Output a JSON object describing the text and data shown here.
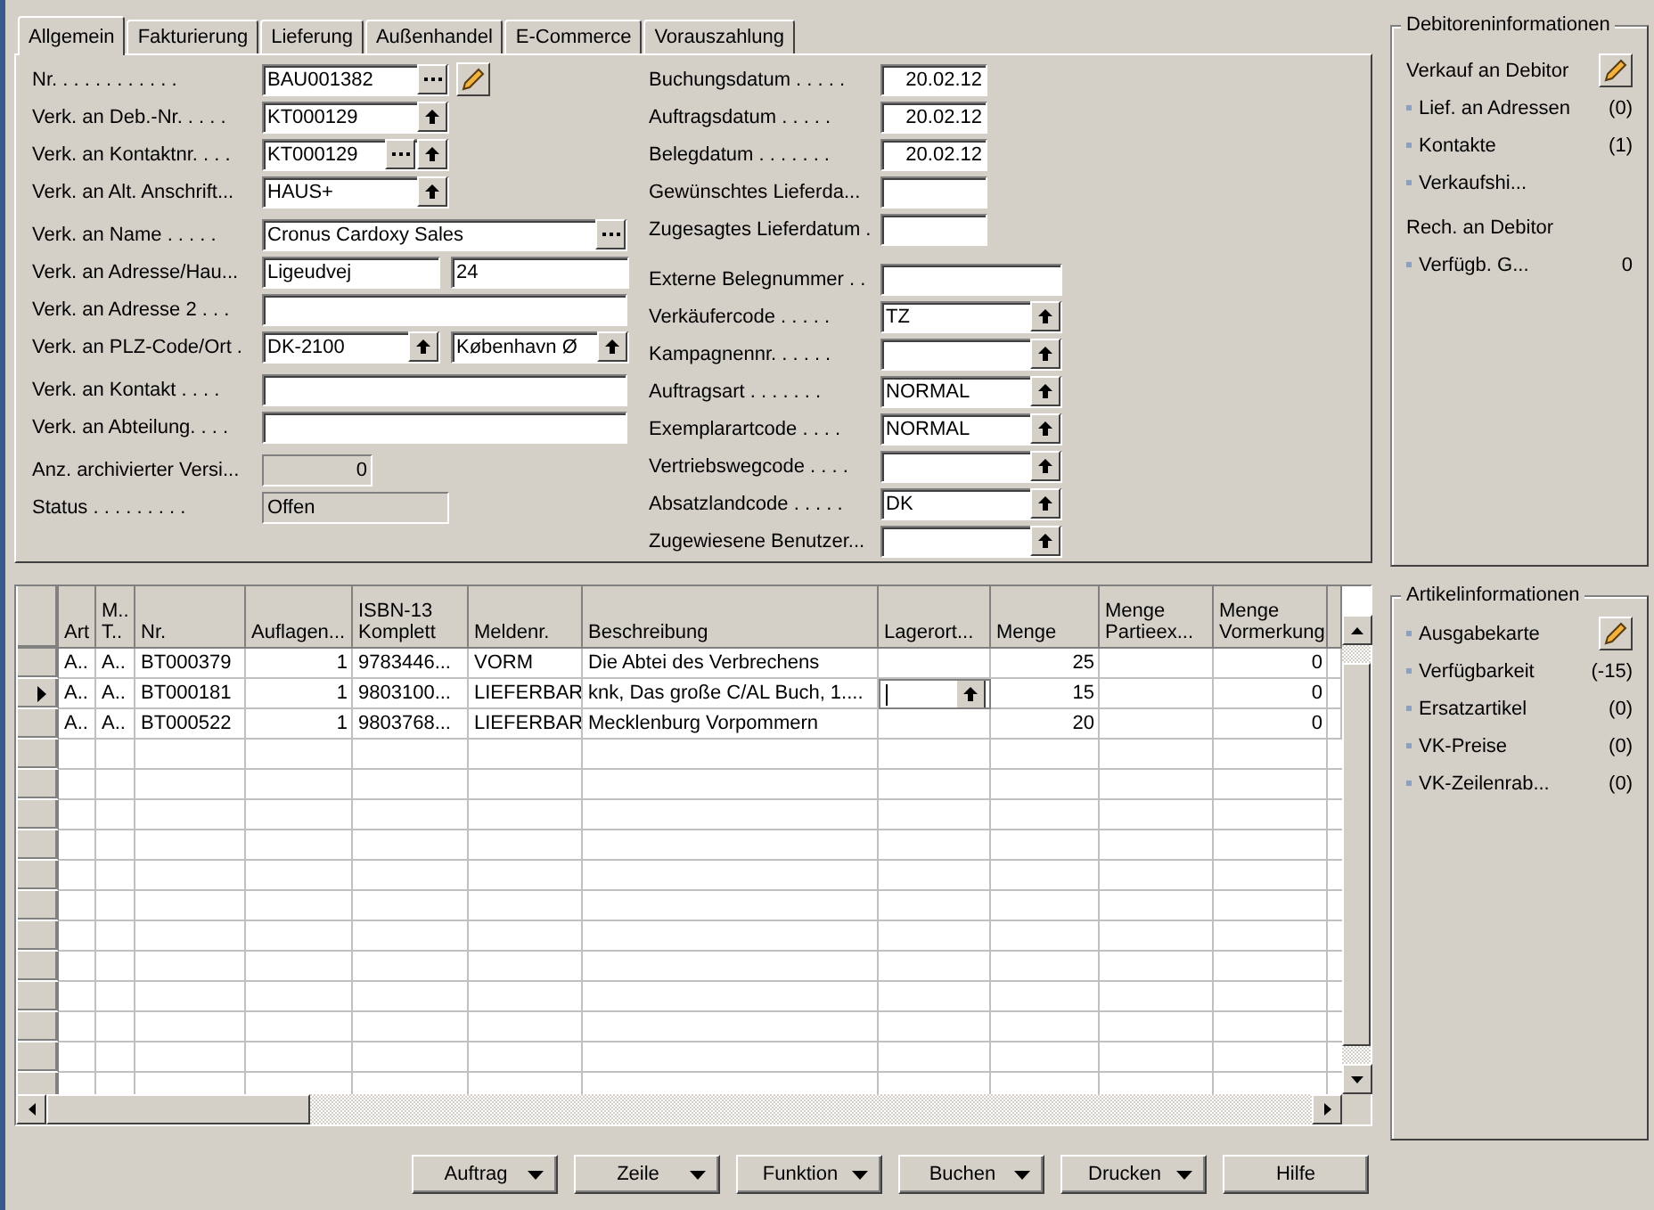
{
  "tabs": [
    {
      "label": "Allgemein",
      "selected": true
    },
    {
      "label": "Fakturierung",
      "selected": false
    },
    {
      "label": "Lieferung",
      "selected": false
    },
    {
      "label": "Außenhandel",
      "selected": false
    },
    {
      "label": "E-Commerce",
      "selected": false
    },
    {
      "label": "Vorauszahlung",
      "selected": false
    }
  ],
  "form": {
    "left_groups": [
      {
        "rows": [
          {
            "label": "Nr. . . . . . . . . . . .",
            "fields": [
              {
                "value": "BAU001382",
                "kind": "code",
                "assist": true,
                "lookup": false,
                "edit": true,
                "disabled": false
              }
            ]
          },
          {
            "label": "Verk. an Deb.-Nr. . . . .",
            "fields": [
              {
                "value": "KT000129",
                "kind": "code",
                "assist": false,
                "lookup": true,
                "edit": false,
                "disabled": false
              }
            ]
          },
          {
            "label": "Verk. an Kontaktnr. . . .",
            "fields": [
              {
                "value": "KT000129",
                "kind": "code",
                "assist": true,
                "lookup": true,
                "edit": false,
                "disabled": false
              }
            ]
          },
          {
            "label": "Verk. an Alt. Anschrift...",
            "fields": [
              {
                "value": "HAUS+",
                "kind": "code",
                "assist": false,
                "lookup": true,
                "edit": false,
                "disabled": false
              }
            ]
          }
        ]
      },
      {
        "rows": [
          {
            "label": "Verk. an Name . . . . .",
            "fields": [
              {
                "value": "Cronus Cardoxy Sales",
                "kind": "wide",
                "assist": true,
                "lookup": false,
                "edit": false,
                "disabled": false
              }
            ]
          },
          {
            "label": "Verk. an Adresse/Hau...",
            "fields": [
              {
                "value": "Ligeudvej",
                "kind": "half",
                "assist": false,
                "lookup": false,
                "edit": false,
                "disabled": false
              },
              {
                "value": "24",
                "kind": "half",
                "assist": false,
                "lookup": false,
                "edit": false,
                "disabled": false
              }
            ]
          },
          {
            "label": "Verk. an Adresse 2 . . .",
            "fields": [
              {
                "kind": "wide",
                "assist": false,
                "lookup": false,
                "edit": false,
                "disabled": false
              }
            ]
          },
          {
            "label": "Verk. an PLZ-Code/Ort .",
            "fields": [
              {
                "value": "DK-2100",
                "kind": "half",
                "assist": false,
                "lookup": true,
                "edit": false,
                "disabled": false
              },
              {
                "value": "København Ø",
                "kind": "half",
                "assist": false,
                "lookup": true,
                "edit": false,
                "disabled": false
              }
            ]
          }
        ]
      },
      {
        "rows": [
          {
            "label": "Verk. an Kontakt . . . .",
            "fields": [
              {
                "kind": "wide",
                "assist": false,
                "lookup": false,
                "edit": false,
                "disabled": false
              }
            ]
          },
          {
            "label": "Verk. an Abteilung. . . .",
            "fields": [
              {
                "kind": "wide",
                "assist": false,
                "lookup": false,
                "edit": false,
                "disabled": false
              }
            ]
          }
        ]
      },
      {
        "rows": [
          {
            "label": "Anz. archivierter Versi...",
            "fields": [
              {
                "value": "0",
                "kind": "number",
                "assist": false,
                "lookup": false,
                "edit": false,
                "disabled": true
              }
            ]
          },
          {
            "label": "Status . . . . . . . . .",
            "fields": [
              {
                "value": "Offen",
                "kind": "code",
                "assist": false,
                "lookup": false,
                "edit": false,
                "disabled": true
              }
            ]
          }
        ]
      }
    ],
    "right_groups": [
      {
        "rows": [
          {
            "label": "Buchungsdatum . . . . .",
            "fields": [
              {
                "value": "20.02.12",
                "kind": "date",
                "assist": false,
                "lookup": false,
                "edit": false,
                "disabled": false
              }
            ]
          },
          {
            "label": "Auftragsdatum . . . . .",
            "fields": [
              {
                "value": "20.02.12",
                "kind": "date",
                "assist": false,
                "lookup": false,
                "edit": false,
                "disabled": false
              }
            ]
          },
          {
            "label": "Belegdatum . . . . . . .",
            "fields": [
              {
                "value": "20.02.12",
                "kind": "date",
                "assist": false,
                "lookup": false,
                "edit": false,
                "disabled": false
              }
            ]
          },
          {
            "label": "Gewünschtes Lieferda...",
            "fields": [
              {
                "kind": "date",
                "assist": false,
                "lookup": false,
                "edit": false,
                "disabled": false
              }
            ]
          },
          {
            "label": "Zugesagtes Lieferdatum .",
            "fields": [
              {
                "kind": "date",
                "assist": false,
                "lookup": false,
                "edit": false,
                "disabled": false
              }
            ]
          }
        ]
      },
      {
        "rows": [
          {
            "label": "Externe Belegnummer . .",
            "fields": [
              {
                "kind": "code",
                "assist": false,
                "lookup": false,
                "edit": false,
                "disabled": false
              }
            ]
          },
          {
            "label": "Verkäufercode . . . . .",
            "fields": [
              {
                "value": "TZ",
                "kind": "code",
                "assist": false,
                "lookup": true,
                "edit": false,
                "disabled": false
              }
            ]
          },
          {
            "label": "Kampagnennr. . . . . .",
            "fields": [
              {
                "kind": "code",
                "assist": false,
                "lookup": true,
                "edit": false,
                "disabled": false
              }
            ]
          },
          {
            "label": "Auftragsart . . . . . . .",
            "fields": [
              {
                "value": "NORMAL",
                "kind": "code",
                "assist": false,
                "lookup": true,
                "edit": false,
                "disabled": false
              }
            ]
          },
          {
            "label": "Exemplarartcode . . . .",
            "fields": [
              {
                "value": "NORMAL",
                "kind": "code",
                "assist": false,
                "lookup": true,
                "edit": false,
                "disabled": false
              }
            ]
          },
          {
            "label": "Vertriebswegcode . . . .",
            "fields": [
              {
                "kind": "code",
                "assist": false,
                "lookup": true,
                "edit": false,
                "disabled": false
              }
            ]
          },
          {
            "label": "Absatzlandcode . . . . .",
            "fields": [
              {
                "value": "DK",
                "kind": "code",
                "assist": false,
                "lookup": true,
                "edit": false,
                "disabled": false
              }
            ]
          },
          {
            "label": "Zugewiesene Benutzer...",
            "fields": [
              {
                "kind": "code",
                "assist": false,
                "lookup": true,
                "edit": false,
                "disabled": false
              }
            ]
          }
        ]
      }
    ]
  },
  "lines": {
    "columns": [
      {
        "header": "Art",
        "kind": "text"
      },
      {
        "header": "M.. T..",
        "kind": "text"
      },
      {
        "header": "Nr.",
        "kind": "text"
      },
      {
        "header": "Auflagen...",
        "kind": "number"
      },
      {
        "header": "ISBN-13 Komplett",
        "kind": "text"
      },
      {
        "header": "Meldenr.",
        "kind": "text"
      },
      {
        "header": "Beschreibung",
        "kind": "text"
      },
      {
        "header": "Lagerort...",
        "kind": "lookup"
      },
      {
        "header": "Menge",
        "kind": "number"
      },
      {
        "header": "Menge Partieex...",
        "kind": "blank"
      },
      {
        "header": "Menge Vormerkung",
        "kind": "number"
      }
    ],
    "rows": [
      {
        "selected": false,
        "cells": [
          "A..",
          "A..",
          "BT000379",
          "1",
          "9783446...",
          "VORM",
          "Die Abtei des Verbrechens",
          "25",
          "0"
        ]
      },
      {
        "selected": true,
        "cells": [
          "A..",
          "A..",
          "BT000181",
          "1",
          "9803100...",
          "LIEFERBAR",
          "knk, Das große C/AL Buch, 1....",
          "15",
          "0"
        ]
      },
      {
        "selected": false,
        "cells": [
          "A..",
          "A..",
          "BT000522",
          "1",
          "9803768...",
          "LIEFERBAR",
          "Mecklenburg Vorpommern",
          "20",
          "0"
        ]
      }
    ]
  },
  "actions": [
    {
      "label": "Auftrag",
      "menu": true
    },
    {
      "label": "Zeile",
      "menu": true
    },
    {
      "label": "Funktion",
      "menu": true
    },
    {
      "label": "Buchen",
      "menu": true
    },
    {
      "label": "Drucken",
      "menu": true
    },
    {
      "label": "Hilfe",
      "menu": false
    }
  ],
  "info_panels": [
    {
      "title": "Debitoreninformationen",
      "items": [
        {
          "kind": "heading",
          "label": "Verkauf an Debitor",
          "edit": true
        },
        {
          "kind": "link",
          "label": "Lief. an Adressen",
          "count": "(0)",
          "edit": false
        },
        {
          "kind": "link",
          "label": "Kontakte",
          "count": "(1)",
          "edit": false
        },
        {
          "kind": "link",
          "label": "Verkaufshi...",
          "edit": false
        },
        {
          "kind": "heading",
          "label": "Rech. an Debitor",
          "edit": false
        },
        {
          "kind": "link",
          "label": "Verfügb. G...",
          "count": "0",
          "edit": false
        }
      ]
    },
    {
      "title": "Artikelinformationen",
      "items": [
        {
          "kind": "link",
          "label": "Ausgabekarte",
          "edit": true
        },
        {
          "kind": "link",
          "label": "Verfügbarkeit",
          "count": "(-15)",
          "edit": false
        },
        {
          "kind": "link",
          "label": "Ersatzartikel",
          "count": "(0)",
          "edit": false
        },
        {
          "kind": "link",
          "label": "VK-Preise",
          "count": "(0)",
          "edit": false
        },
        {
          "kind": "link",
          "label": "VK-Zeilenrab...",
          "count": "(0)",
          "edit": false
        }
      ]
    }
  ]
}
